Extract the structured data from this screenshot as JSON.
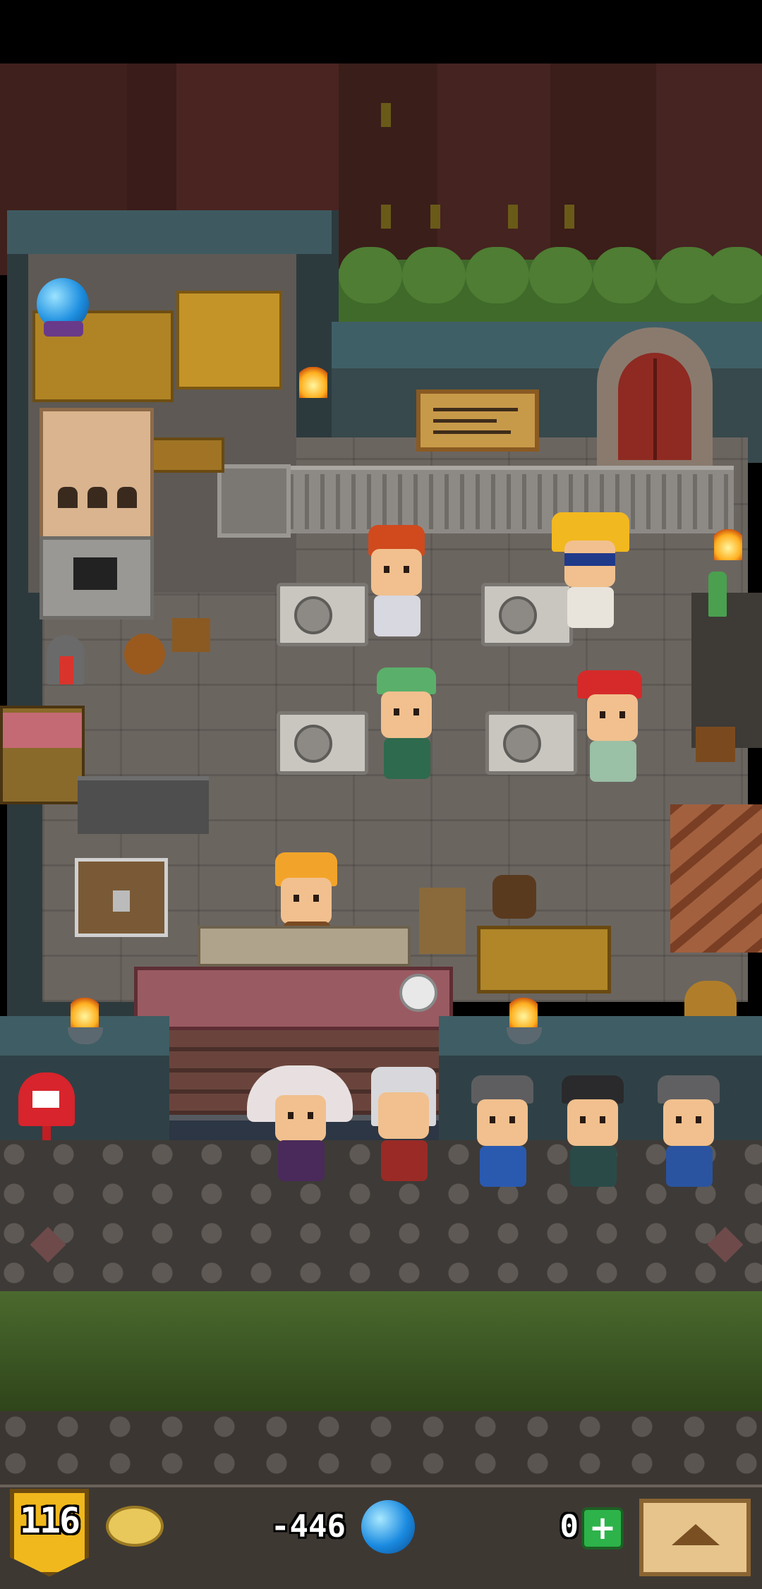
{
  "hud": {
    "level": "116",
    "gold": "-446",
    "gems": "0",
    "add_button_label": "+"
  },
  "icons": {
    "level": "shield-level-badge",
    "gold": "gold-coin-icon",
    "gems": "blue-gem-icon",
    "add": "plus-icon",
    "menu": "up-arrow-icon"
  },
  "colors": {
    "level_badge": "#f0b81c",
    "add_button": "#2db34a",
    "gem": "#1a8ae0"
  }
}
